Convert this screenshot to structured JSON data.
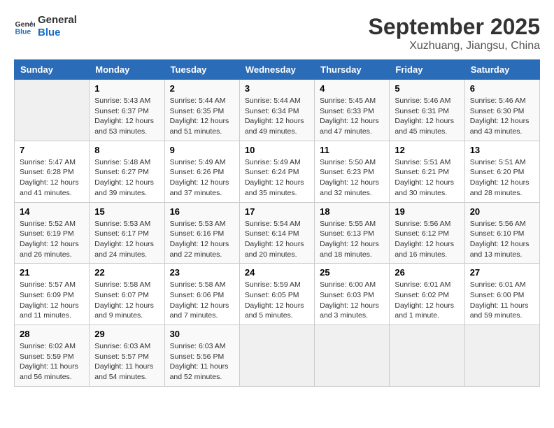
{
  "header": {
    "logo_line1": "General",
    "logo_line2": "Blue",
    "month": "September 2025",
    "location": "Xuzhuang, Jiangsu, China"
  },
  "weekdays": [
    "Sunday",
    "Monday",
    "Tuesday",
    "Wednesday",
    "Thursday",
    "Friday",
    "Saturday"
  ],
  "weeks": [
    [
      {
        "num": "",
        "info": ""
      },
      {
        "num": "1",
        "info": "Sunrise: 5:43 AM\nSunset: 6:37 PM\nDaylight: 12 hours\nand 53 minutes."
      },
      {
        "num": "2",
        "info": "Sunrise: 5:44 AM\nSunset: 6:35 PM\nDaylight: 12 hours\nand 51 minutes."
      },
      {
        "num": "3",
        "info": "Sunrise: 5:44 AM\nSunset: 6:34 PM\nDaylight: 12 hours\nand 49 minutes."
      },
      {
        "num": "4",
        "info": "Sunrise: 5:45 AM\nSunset: 6:33 PM\nDaylight: 12 hours\nand 47 minutes."
      },
      {
        "num": "5",
        "info": "Sunrise: 5:46 AM\nSunset: 6:31 PM\nDaylight: 12 hours\nand 45 minutes."
      },
      {
        "num": "6",
        "info": "Sunrise: 5:46 AM\nSunset: 6:30 PM\nDaylight: 12 hours\nand 43 minutes."
      }
    ],
    [
      {
        "num": "7",
        "info": "Sunrise: 5:47 AM\nSunset: 6:28 PM\nDaylight: 12 hours\nand 41 minutes."
      },
      {
        "num": "8",
        "info": "Sunrise: 5:48 AM\nSunset: 6:27 PM\nDaylight: 12 hours\nand 39 minutes."
      },
      {
        "num": "9",
        "info": "Sunrise: 5:49 AM\nSunset: 6:26 PM\nDaylight: 12 hours\nand 37 minutes."
      },
      {
        "num": "10",
        "info": "Sunrise: 5:49 AM\nSunset: 6:24 PM\nDaylight: 12 hours\nand 35 minutes."
      },
      {
        "num": "11",
        "info": "Sunrise: 5:50 AM\nSunset: 6:23 PM\nDaylight: 12 hours\nand 32 minutes."
      },
      {
        "num": "12",
        "info": "Sunrise: 5:51 AM\nSunset: 6:21 PM\nDaylight: 12 hours\nand 30 minutes."
      },
      {
        "num": "13",
        "info": "Sunrise: 5:51 AM\nSunset: 6:20 PM\nDaylight: 12 hours\nand 28 minutes."
      }
    ],
    [
      {
        "num": "14",
        "info": "Sunrise: 5:52 AM\nSunset: 6:19 PM\nDaylight: 12 hours\nand 26 minutes."
      },
      {
        "num": "15",
        "info": "Sunrise: 5:53 AM\nSunset: 6:17 PM\nDaylight: 12 hours\nand 24 minutes."
      },
      {
        "num": "16",
        "info": "Sunrise: 5:53 AM\nSunset: 6:16 PM\nDaylight: 12 hours\nand 22 minutes."
      },
      {
        "num": "17",
        "info": "Sunrise: 5:54 AM\nSunset: 6:14 PM\nDaylight: 12 hours\nand 20 minutes."
      },
      {
        "num": "18",
        "info": "Sunrise: 5:55 AM\nSunset: 6:13 PM\nDaylight: 12 hours\nand 18 minutes."
      },
      {
        "num": "19",
        "info": "Sunrise: 5:56 AM\nSunset: 6:12 PM\nDaylight: 12 hours\nand 16 minutes."
      },
      {
        "num": "20",
        "info": "Sunrise: 5:56 AM\nSunset: 6:10 PM\nDaylight: 12 hours\nand 13 minutes."
      }
    ],
    [
      {
        "num": "21",
        "info": "Sunrise: 5:57 AM\nSunset: 6:09 PM\nDaylight: 12 hours\nand 11 minutes."
      },
      {
        "num": "22",
        "info": "Sunrise: 5:58 AM\nSunset: 6:07 PM\nDaylight: 12 hours\nand 9 minutes."
      },
      {
        "num": "23",
        "info": "Sunrise: 5:58 AM\nSunset: 6:06 PM\nDaylight: 12 hours\nand 7 minutes."
      },
      {
        "num": "24",
        "info": "Sunrise: 5:59 AM\nSunset: 6:05 PM\nDaylight: 12 hours\nand 5 minutes."
      },
      {
        "num": "25",
        "info": "Sunrise: 6:00 AM\nSunset: 6:03 PM\nDaylight: 12 hours\nand 3 minutes."
      },
      {
        "num": "26",
        "info": "Sunrise: 6:01 AM\nSunset: 6:02 PM\nDaylight: 12 hours\nand 1 minute."
      },
      {
        "num": "27",
        "info": "Sunrise: 6:01 AM\nSunset: 6:00 PM\nDaylight: 11 hours\nand 59 minutes."
      }
    ],
    [
      {
        "num": "28",
        "info": "Sunrise: 6:02 AM\nSunset: 5:59 PM\nDaylight: 11 hours\nand 56 minutes."
      },
      {
        "num": "29",
        "info": "Sunrise: 6:03 AM\nSunset: 5:57 PM\nDaylight: 11 hours\nand 54 minutes."
      },
      {
        "num": "30",
        "info": "Sunrise: 6:03 AM\nSunset: 5:56 PM\nDaylight: 11 hours\nand 52 minutes."
      },
      {
        "num": "",
        "info": ""
      },
      {
        "num": "",
        "info": ""
      },
      {
        "num": "",
        "info": ""
      },
      {
        "num": "",
        "info": ""
      }
    ]
  ]
}
